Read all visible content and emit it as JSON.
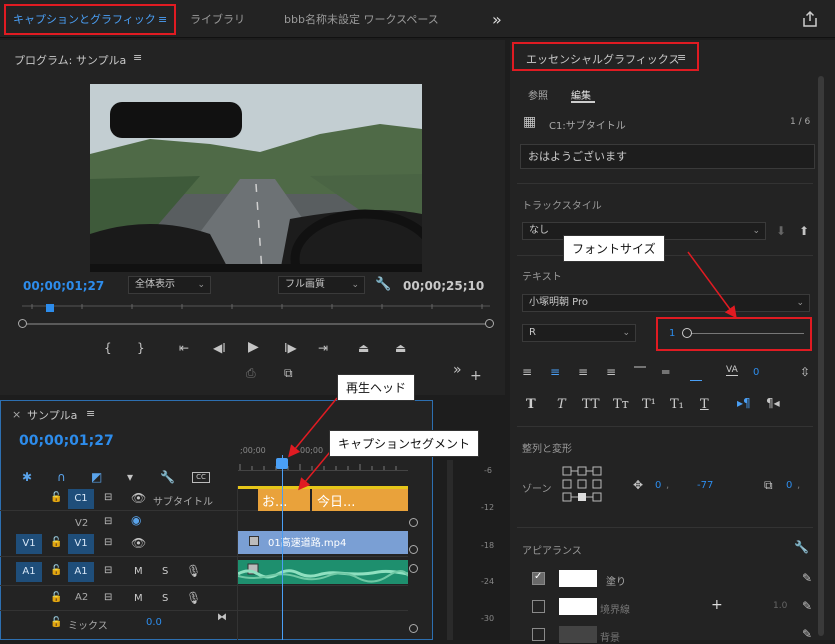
{
  "tabs": {
    "captions": "キャプションとグラフィック",
    "library": "ライブラリ",
    "workspace": "bbb名称未設定 ワークスペース",
    "menu": "≡",
    "more": "»"
  },
  "program": {
    "title": "プログラム: サンプルa",
    "menu": "≡",
    "timecode": "00;00;01;27",
    "zoom": "全体表示",
    "quality": "フル画質",
    "duration": "00;00;25;10"
  },
  "essential": {
    "title": "エッセンシャルグラフィックス",
    "menu": "≡",
    "tab_browse": "参照",
    "tab_edit": "編集",
    "layer_name": "C1:サブタイトル",
    "layer_count": "1 / 6",
    "caption_text": "おはようございます",
    "track_style_label": "トラックスタイル",
    "track_style_value": "なし",
    "text_label": "テキスト",
    "font": "小塚明朝 Pro",
    "font_style": "R",
    "font_size": "1",
    "tracking": "0",
    "align_label": "整列と変形",
    "zone_label": "ゾーン",
    "pos_x": "0",
    "pos_y": "-77",
    "scale": "0",
    "appearance_label": "アピアランス",
    "fill_label": "塗り",
    "stroke_label": "境界線",
    "stroke_width": "1.0",
    "bg_label": "背景"
  },
  "timeline": {
    "title": "サンプルa",
    "menu": "≡",
    "timecode": "00;00;01;27",
    "ruler_start": ";00;00",
    "ruler_next": "00;00",
    "c1_name": "サブタイトル",
    "seg1": "お...",
    "seg2": "今日...",
    "clip_name": "01高速道路.mp4",
    "mix_label": "ミックス",
    "mix_value": "0.0",
    "tracks": {
      "c1": "C1",
      "v2": "V2",
      "v1src": "V1",
      "v1": "V1",
      "a1src": "A1",
      "a1": "A1",
      "a2": "A2"
    },
    "meter_ticks": [
      "-6",
      "-12",
      "-18",
      "-24",
      "-30"
    ]
  },
  "callouts": {
    "font_size": "フォントサイズ",
    "playhead": "再生ヘッド",
    "caption_segment": "キャプションセグメント"
  },
  "colors": {
    "accent": "#2d8ceb",
    "highlight_box": "#e01b22",
    "caption_bar": "#e9a23b",
    "video_clip": "#7a9fd4",
    "audio_clip": "#1e8f6e"
  }
}
